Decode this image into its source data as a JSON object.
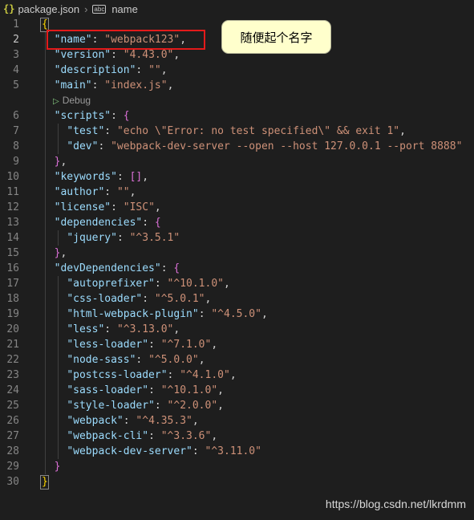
{
  "breadcrumb": {
    "json_icon_glyph": "{}",
    "file": "package.json",
    "sep": "›",
    "symbol_icon_glyph": "abc",
    "symbol": "name"
  },
  "codelens": {
    "label": "Debug",
    "icon": "play-triangle"
  },
  "annotation": {
    "callout": "随便起个名字"
  },
  "watermark": "https://blog.csdn.net/lkrdmm",
  "colors": {
    "key": "#9cdcfe",
    "string": "#ce9178",
    "highlight": "#e31a1a",
    "callout_bg": "#ffffcc"
  },
  "editor": {
    "active_line": 2,
    "lines": [
      {
        "n": "1",
        "tokens": [
          {
            "t": "{",
            "c": "br1"
          }
        ]
      },
      {
        "n": "2",
        "tokens": [
          {
            "t": "  "
          },
          {
            "t": "\"name\"",
            "c": "key"
          },
          {
            "t": ": ",
            "c": "punc"
          },
          {
            "t": "\"webpack123\"",
            "c": "str"
          },
          {
            "t": ",",
            "c": "punc"
          }
        ]
      },
      {
        "n": "3",
        "tokens": [
          {
            "t": "  "
          },
          {
            "t": "\"version\"",
            "c": "key"
          },
          {
            "t": ": ",
            "c": "punc"
          },
          {
            "t": "\"4.43.0\"",
            "c": "str"
          },
          {
            "t": ",",
            "c": "punc"
          }
        ]
      },
      {
        "n": "4",
        "tokens": [
          {
            "t": "  "
          },
          {
            "t": "\"description\"",
            "c": "key"
          },
          {
            "t": ": ",
            "c": "punc"
          },
          {
            "t": "\"\"",
            "c": "str"
          },
          {
            "t": ",",
            "c": "punc"
          }
        ]
      },
      {
        "n": "5",
        "tokens": [
          {
            "t": "  "
          },
          {
            "t": "\"main\"",
            "c": "key"
          },
          {
            "t": ": ",
            "c": "punc"
          },
          {
            "t": "\"index.js\"",
            "c": "str"
          },
          {
            "t": ",",
            "c": "punc"
          }
        ]
      },
      {
        "n": "6",
        "tokens": [
          {
            "t": "  "
          },
          {
            "t": "\"scripts\"",
            "c": "key"
          },
          {
            "t": ": ",
            "c": "punc"
          },
          {
            "t": "{",
            "c": "br2"
          }
        ]
      },
      {
        "n": "7",
        "tokens": [
          {
            "t": "    "
          },
          {
            "t": "\"test\"",
            "c": "key"
          },
          {
            "t": ": ",
            "c": "punc"
          },
          {
            "t": "\"echo \\\"Error: no test specified\\\" && exit 1\"",
            "c": "str"
          },
          {
            "t": ",",
            "c": "punc"
          }
        ]
      },
      {
        "n": "8",
        "tokens": [
          {
            "t": "    "
          },
          {
            "t": "\"dev\"",
            "c": "key"
          },
          {
            "t": ": ",
            "c": "punc"
          },
          {
            "t": "\"webpack-dev-server --open --host 127.0.0.1 --port 8888\"",
            "c": "str"
          }
        ]
      },
      {
        "n": "9",
        "tokens": [
          {
            "t": "  "
          },
          {
            "t": "}",
            "c": "br2"
          },
          {
            "t": ",",
            "c": "punc"
          }
        ]
      },
      {
        "n": "10",
        "tokens": [
          {
            "t": "  "
          },
          {
            "t": "\"keywords\"",
            "c": "key"
          },
          {
            "t": ": ",
            "c": "punc"
          },
          {
            "t": "[]",
            "c": "br2"
          },
          {
            "t": ",",
            "c": "punc"
          }
        ]
      },
      {
        "n": "11",
        "tokens": [
          {
            "t": "  "
          },
          {
            "t": "\"author\"",
            "c": "key"
          },
          {
            "t": ": ",
            "c": "punc"
          },
          {
            "t": "\"\"",
            "c": "str"
          },
          {
            "t": ",",
            "c": "punc"
          }
        ]
      },
      {
        "n": "12",
        "tokens": [
          {
            "t": "  "
          },
          {
            "t": "\"license\"",
            "c": "key"
          },
          {
            "t": ": ",
            "c": "punc"
          },
          {
            "t": "\"ISC\"",
            "c": "str"
          },
          {
            "t": ",",
            "c": "punc"
          }
        ]
      },
      {
        "n": "13",
        "tokens": [
          {
            "t": "  "
          },
          {
            "t": "\"dependencies\"",
            "c": "key"
          },
          {
            "t": ": ",
            "c": "punc"
          },
          {
            "t": "{",
            "c": "br2"
          }
        ]
      },
      {
        "n": "14",
        "tokens": [
          {
            "t": "    "
          },
          {
            "t": "\"jquery\"",
            "c": "key"
          },
          {
            "t": ": ",
            "c": "punc"
          },
          {
            "t": "\"^3.5.1\"",
            "c": "str"
          }
        ]
      },
      {
        "n": "15",
        "tokens": [
          {
            "t": "  "
          },
          {
            "t": "}",
            "c": "br2"
          },
          {
            "t": ",",
            "c": "punc"
          }
        ]
      },
      {
        "n": "16",
        "tokens": [
          {
            "t": "  "
          },
          {
            "t": "\"devDependencies\"",
            "c": "key"
          },
          {
            "t": ": ",
            "c": "punc"
          },
          {
            "t": "{",
            "c": "br2"
          }
        ]
      },
      {
        "n": "17",
        "tokens": [
          {
            "t": "    "
          },
          {
            "t": "\"autoprefixer\"",
            "c": "key"
          },
          {
            "t": ": ",
            "c": "punc"
          },
          {
            "t": "\"^10.1.0\"",
            "c": "str"
          },
          {
            "t": ",",
            "c": "punc"
          }
        ]
      },
      {
        "n": "18",
        "tokens": [
          {
            "t": "    "
          },
          {
            "t": "\"css-loader\"",
            "c": "key"
          },
          {
            "t": ": ",
            "c": "punc"
          },
          {
            "t": "\"^5.0.1\"",
            "c": "str"
          },
          {
            "t": ",",
            "c": "punc"
          }
        ]
      },
      {
        "n": "19",
        "tokens": [
          {
            "t": "    "
          },
          {
            "t": "\"html-webpack-plugin\"",
            "c": "key"
          },
          {
            "t": ": ",
            "c": "punc"
          },
          {
            "t": "\"^4.5.0\"",
            "c": "str"
          },
          {
            "t": ",",
            "c": "punc"
          }
        ]
      },
      {
        "n": "20",
        "tokens": [
          {
            "t": "    "
          },
          {
            "t": "\"less\"",
            "c": "key"
          },
          {
            "t": ": ",
            "c": "punc"
          },
          {
            "t": "\"^3.13.0\"",
            "c": "str"
          },
          {
            "t": ",",
            "c": "punc"
          }
        ]
      },
      {
        "n": "21",
        "tokens": [
          {
            "t": "    "
          },
          {
            "t": "\"less-loader\"",
            "c": "key"
          },
          {
            "t": ": ",
            "c": "punc"
          },
          {
            "t": "\"^7.1.0\"",
            "c": "str"
          },
          {
            "t": ",",
            "c": "punc"
          }
        ]
      },
      {
        "n": "22",
        "tokens": [
          {
            "t": "    "
          },
          {
            "t": "\"node-sass\"",
            "c": "key"
          },
          {
            "t": ": ",
            "c": "punc"
          },
          {
            "t": "\"^5.0.0\"",
            "c": "str"
          },
          {
            "t": ",",
            "c": "punc"
          }
        ]
      },
      {
        "n": "23",
        "tokens": [
          {
            "t": "    "
          },
          {
            "t": "\"postcss-loader\"",
            "c": "key"
          },
          {
            "t": ": ",
            "c": "punc"
          },
          {
            "t": "\"^4.1.0\"",
            "c": "str"
          },
          {
            "t": ",",
            "c": "punc"
          }
        ]
      },
      {
        "n": "24",
        "tokens": [
          {
            "t": "    "
          },
          {
            "t": "\"sass-loader\"",
            "c": "key"
          },
          {
            "t": ": ",
            "c": "punc"
          },
          {
            "t": "\"^10.1.0\"",
            "c": "str"
          },
          {
            "t": ",",
            "c": "punc"
          }
        ]
      },
      {
        "n": "25",
        "tokens": [
          {
            "t": "    "
          },
          {
            "t": "\"style-loader\"",
            "c": "key"
          },
          {
            "t": ": ",
            "c": "punc"
          },
          {
            "t": "\"^2.0.0\"",
            "c": "str"
          },
          {
            "t": ",",
            "c": "punc"
          }
        ]
      },
      {
        "n": "26",
        "tokens": [
          {
            "t": "    "
          },
          {
            "t": "\"webpack\"",
            "c": "key"
          },
          {
            "t": ": ",
            "c": "punc"
          },
          {
            "t": "\"^4.35.3\"",
            "c": "str"
          },
          {
            "t": ",",
            "c": "punc"
          }
        ]
      },
      {
        "n": "27",
        "tokens": [
          {
            "t": "    "
          },
          {
            "t": "\"webpack-cli\"",
            "c": "key"
          },
          {
            "t": ": ",
            "c": "punc"
          },
          {
            "t": "\"^3.3.6\"",
            "c": "str"
          },
          {
            "t": ",",
            "c": "punc"
          }
        ]
      },
      {
        "n": "28",
        "tokens": [
          {
            "t": "    "
          },
          {
            "t": "\"webpack-dev-server\"",
            "c": "key"
          },
          {
            "t": ": ",
            "c": "punc"
          },
          {
            "t": "\"^3.11.0\"",
            "c": "str"
          }
        ]
      },
      {
        "n": "29",
        "tokens": [
          {
            "t": "  "
          },
          {
            "t": "}",
            "c": "br2"
          }
        ]
      },
      {
        "n": "30",
        "tokens": [
          {
            "t": "}",
            "c": "br1"
          }
        ]
      }
    ]
  }
}
